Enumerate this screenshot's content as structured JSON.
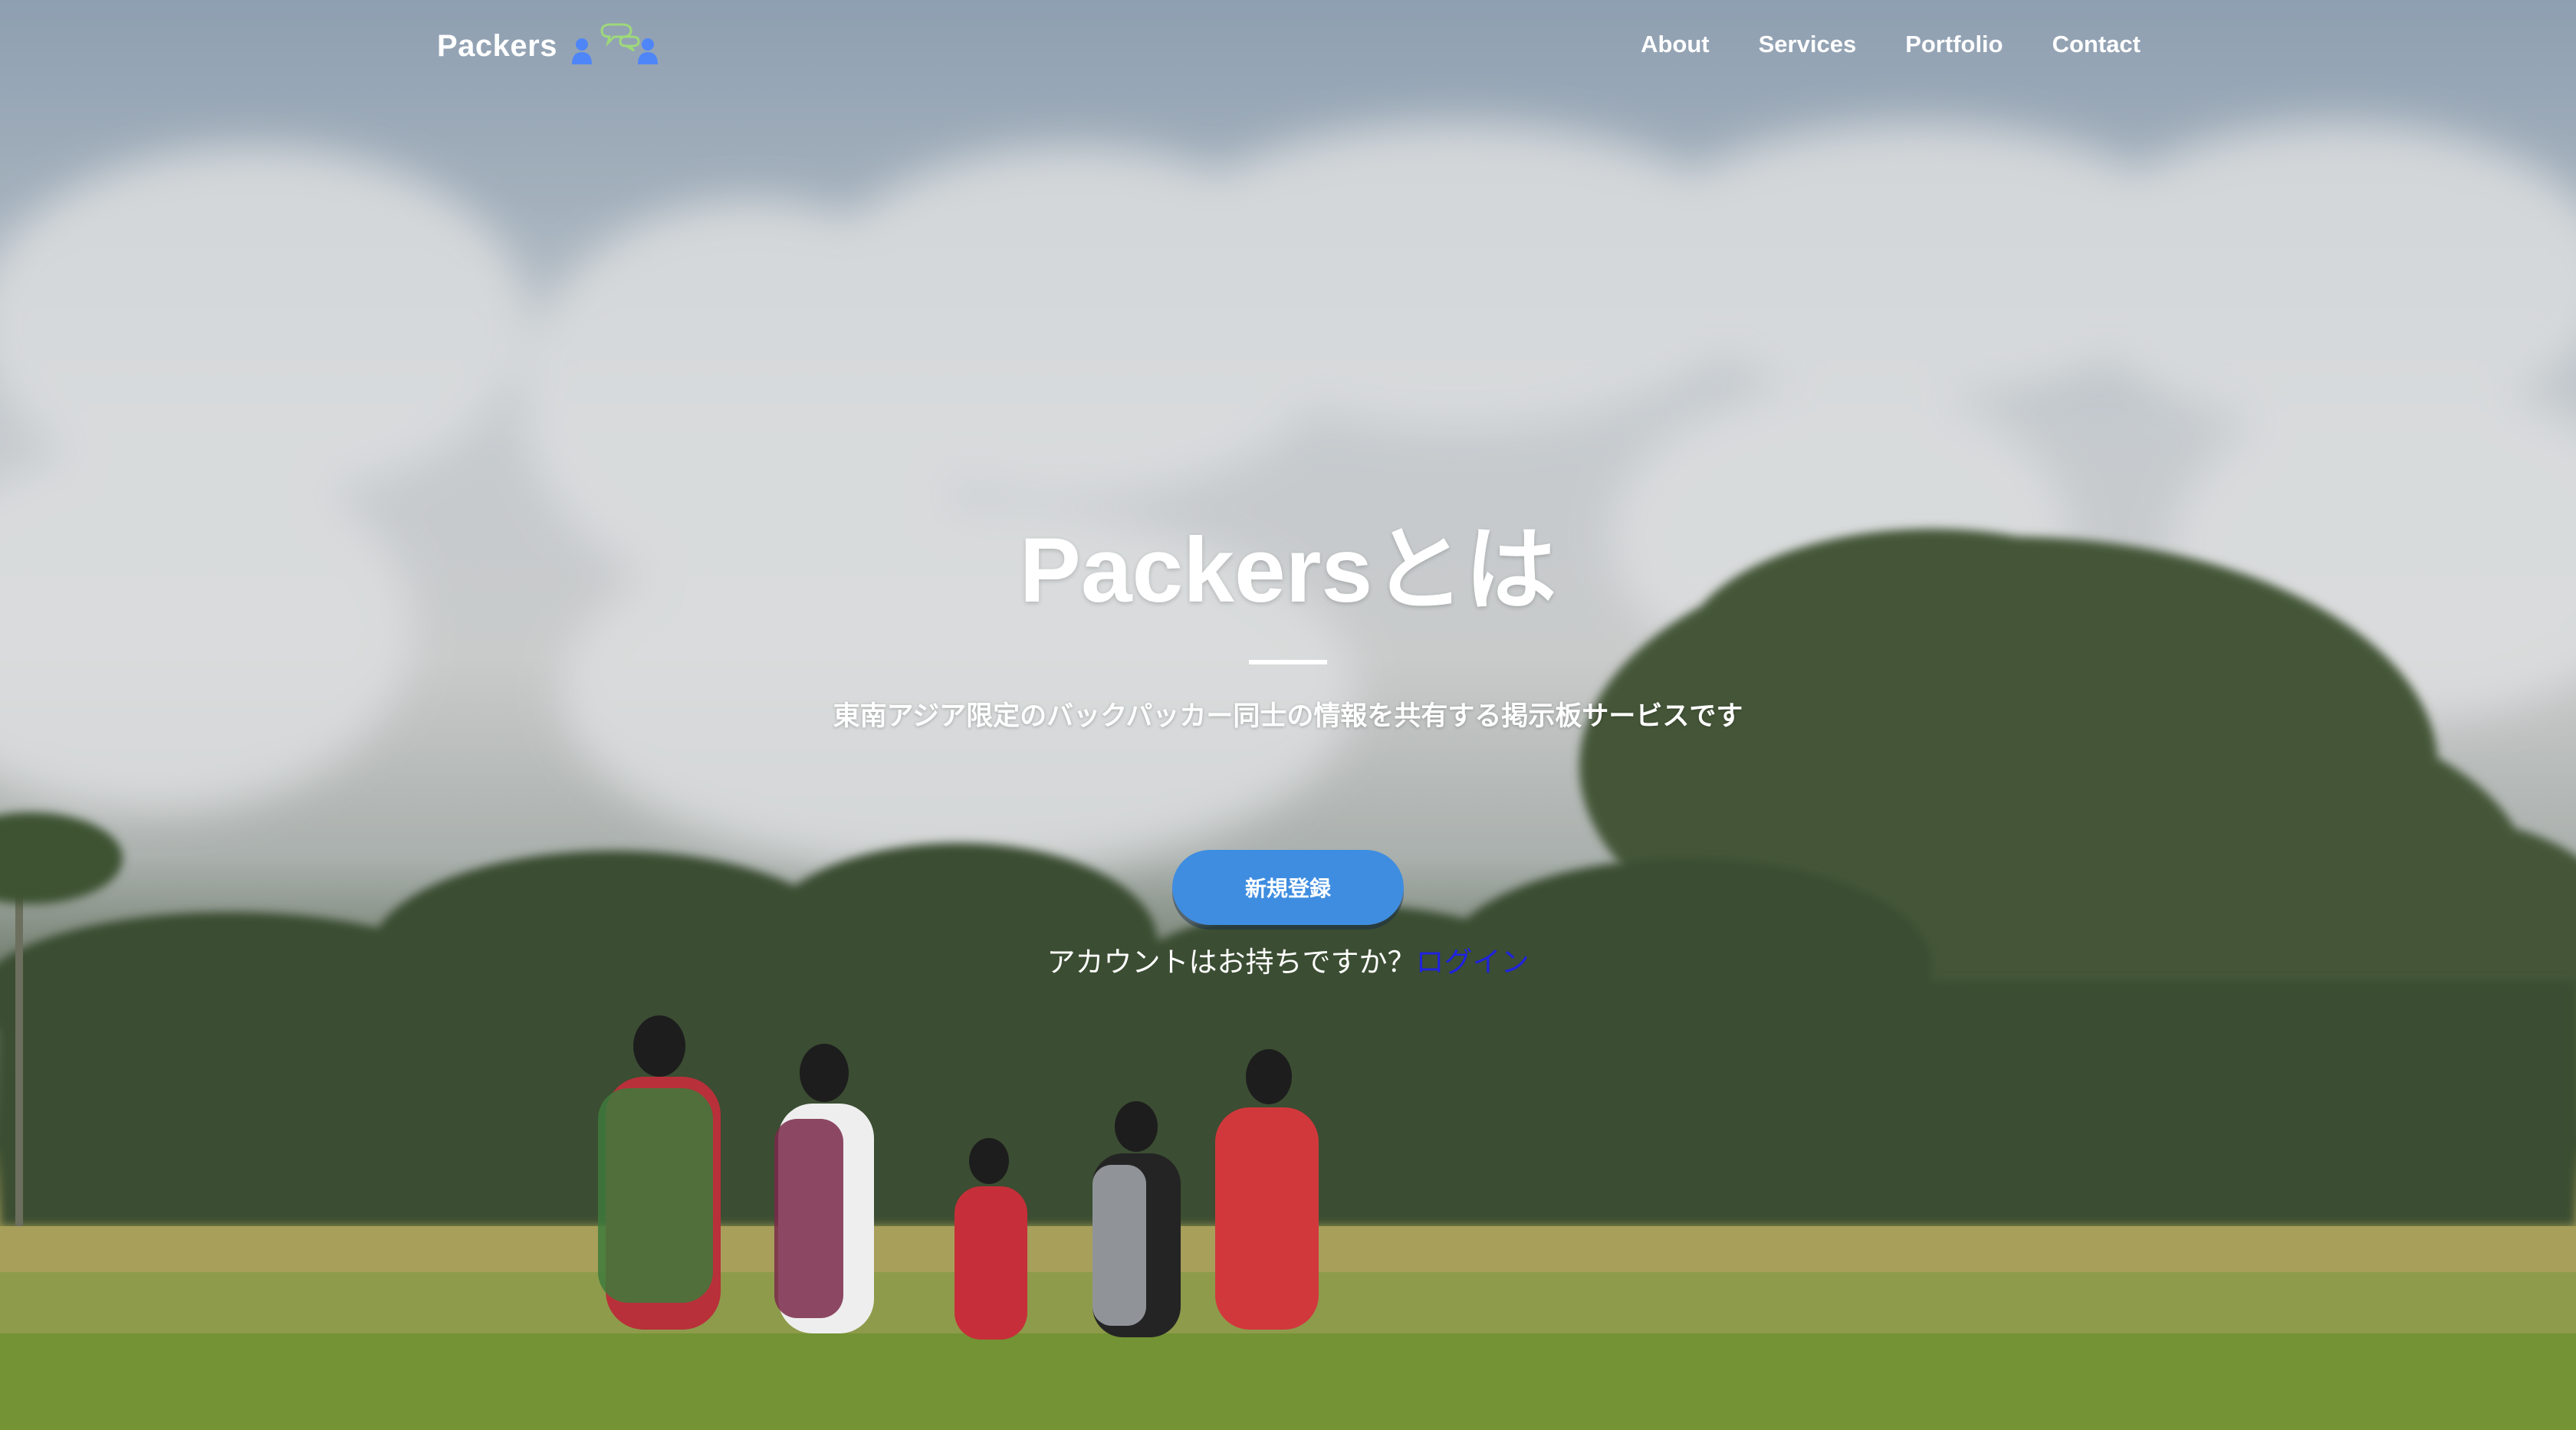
{
  "brand": {
    "name": "Packers",
    "logo_icon": "two-people-chat-icon",
    "logo_person_color": "#4f86f7",
    "logo_bubble_color": "#9ed97a"
  },
  "nav": {
    "links": [
      {
        "label": "About"
      },
      {
        "label": "Services"
      },
      {
        "label": "Portfolio"
      },
      {
        "label": "Contact"
      }
    ]
  },
  "hero": {
    "title": "Packersとは",
    "subtitle": "東南アジア限定のバックパッカー同士の情報を共有する掲示板サービスです",
    "signup_label": "新規登録",
    "login_prompt": "アカウントはお持ちですか？",
    "login_label": "ログイン",
    "background": "backpackers-rice-field-photo"
  },
  "colors": {
    "accent": "#3f8de0",
    "link": "#1f22e0",
    "text": "#ffffff"
  }
}
